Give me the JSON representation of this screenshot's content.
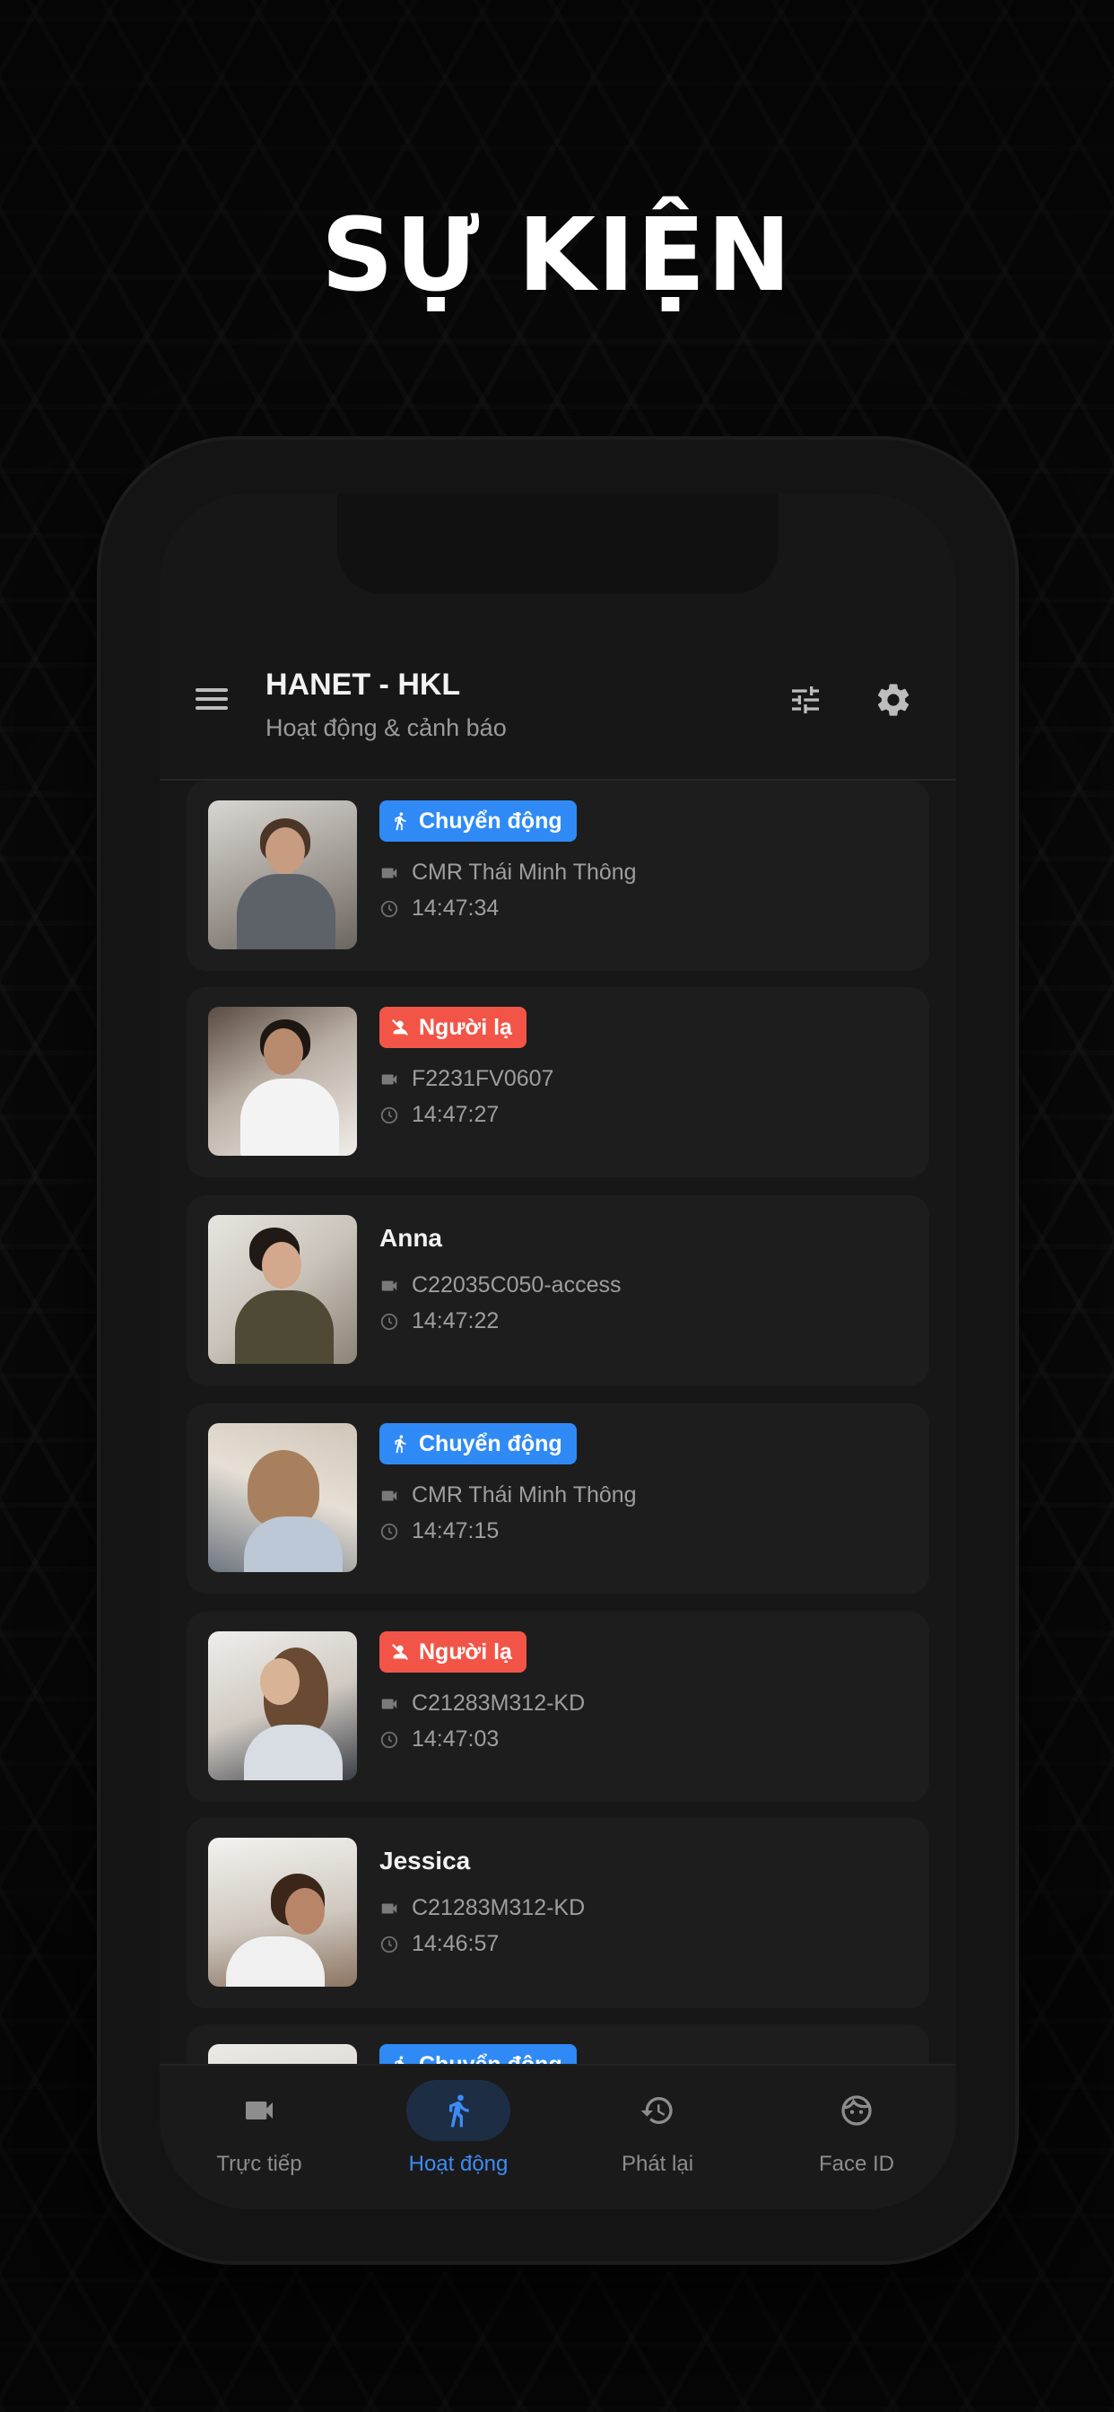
{
  "headline": "SỰ KIỆN",
  "app": {
    "title": "HANET - HKL",
    "subtitle": "Hoạt động & cảnh báo"
  },
  "colors": {
    "motion": "#2f8af6",
    "stranger": "#f25547",
    "accent": "#3d8cf5"
  },
  "events": [
    {
      "type": "motion",
      "badge": "Chuyển động",
      "camera": "CMR Thái Minh Thông",
      "time": "14:47:34"
    },
    {
      "type": "stranger",
      "badge": "Người lạ",
      "camera": "F2231FV0607",
      "time": "14:47:27"
    },
    {
      "type": "person",
      "name": "Anna",
      "camera": "C22035C050-access",
      "time": "14:47:22"
    },
    {
      "type": "motion",
      "badge": "Chuyển động",
      "camera": "CMR Thái Minh Thông",
      "time": "14:47:15"
    },
    {
      "type": "stranger",
      "badge": "Người lạ",
      "camera": "C21283M312-KD",
      "time": "14:47:03"
    },
    {
      "type": "person",
      "name": "Jessica",
      "camera": "C21283M312-KD",
      "time": "14:46:57"
    },
    {
      "type": "motion",
      "badge": "Chuyển động"
    }
  ],
  "nav": [
    {
      "label": "Trực tiếp",
      "icon": "video-camera-icon",
      "active": false
    },
    {
      "label": "Hoạt động",
      "icon": "walking-person-icon",
      "active": true
    },
    {
      "label": "Phát lại",
      "icon": "history-icon",
      "active": false
    },
    {
      "label": "Face ID",
      "icon": "face-icon",
      "active": false
    }
  ]
}
